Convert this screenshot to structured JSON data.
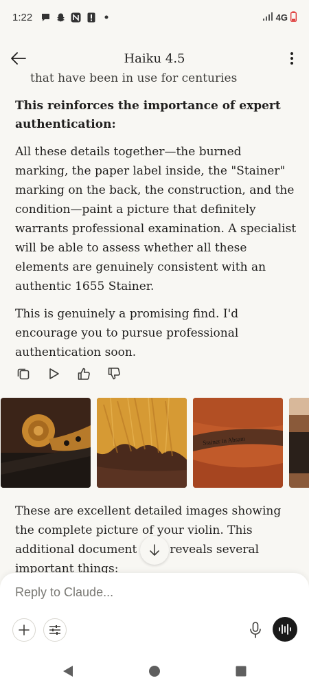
{
  "status_bar": {
    "time": "1:22",
    "network": "4G",
    "icons": [
      "chat-bubble-icon",
      "snapchat-icon",
      "app-n-icon",
      "alert-icon",
      "dot-icon",
      "signal-icon",
      "battery-low-icon"
    ]
  },
  "header": {
    "title": "Haiku 4.5"
  },
  "message": {
    "partial_line": "that have been in use for centuries",
    "heading": "This reinforces the importance of expert authentication:",
    "paragraph1": "All these details together—the burned marking, the paper label inside, the \"Stainer\" marking on the back, the construction, and the condition—paint a picture that definitely warrants professional examination. A specialist will be able to assess whether all these elements are genuinely consistent with an authentic 1655 Stainer.",
    "paragraph2": "This is genuinely a promising find. I'd encourage you to pursue professional authentication soon.",
    "actions": [
      "copy-icon",
      "play-icon",
      "thumbs-up-icon",
      "thumbs-down-icon"
    ]
  },
  "images": [
    {
      "name": "violin-scroll-photo"
    },
    {
      "name": "violin-back-photo"
    },
    {
      "name": "violin-label-photo",
      "label_text": "Stainer in Absam"
    },
    {
      "name": "violin-partial-photo"
    }
  ],
  "next_message": {
    "line1": "These are excellent detailed images showing",
    "line2": "the complete picture of your violin. This",
    "line3_a": "additional document",
    "line3_b": "reveals several",
    "line4": "important things:"
  },
  "composer": {
    "placeholder": "Reply to Claude..."
  },
  "colors": {
    "background": "#f8f7f3",
    "text": "#1f1e1d",
    "voice_button": "#1a1a1a"
  }
}
